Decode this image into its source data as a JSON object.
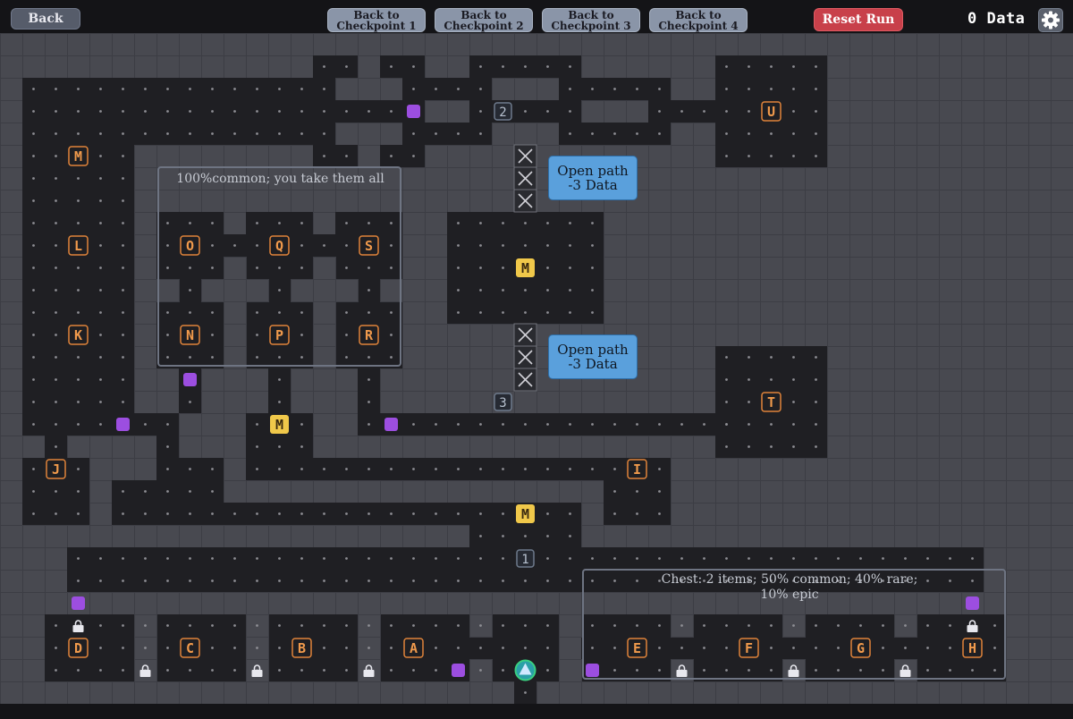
{
  "toolbar": {
    "back_label": "Back",
    "checkpoints": [
      {
        "line1": "Back to",
        "line2": "Checkpoint 1"
      },
      {
        "line1": "Back to",
        "line2": "Checkpoint 2"
      },
      {
        "line1": "Back to",
        "line2": "Checkpoint 3"
      },
      {
        "line1": "Back to",
        "line2": "Checkpoint 4"
      }
    ],
    "reset_label": "Reset Run",
    "data_count": "0 Data",
    "settings_icon": "gear-icon"
  },
  "colors": {
    "wall": "#484950",
    "floor": "#1f1f23",
    "dot": "#8e8e94",
    "node_border": "#e0843a",
    "node_text": "#f09a4c",
    "merchant_fill": "#f0c84a",
    "data_chip": "#9c4ee0",
    "checkpoint_border": "#6e7a8c",
    "open_path_button": "#5aa0dc",
    "reset_button": "#c8404a"
  },
  "room_nodes": [
    "A",
    "B",
    "C",
    "D",
    "E",
    "F",
    "G",
    "H",
    "I",
    "J",
    "K",
    "L",
    "M",
    "N",
    "O",
    "P",
    "Q",
    "R",
    "S",
    "T",
    "U"
  ],
  "merchant_label": "M",
  "checkpoint_labels": [
    "1",
    "2",
    "3"
  ],
  "regions": [
    {
      "label": "100%common; you take them all"
    },
    {
      "label": "Chest: 2 items; 50% common; 40% rare; 10% epic"
    }
  ],
  "open_path_buttons": [
    {
      "line1": "Open path",
      "line2": "-3 Data"
    },
    {
      "line1": "Open path",
      "line2": "-3 Data"
    }
  ],
  "icons": {
    "player": "player-triangle-icon",
    "lock": "lock-icon",
    "blocked": "blocked-x-icon",
    "data_chip": "data-chip-icon"
  }
}
